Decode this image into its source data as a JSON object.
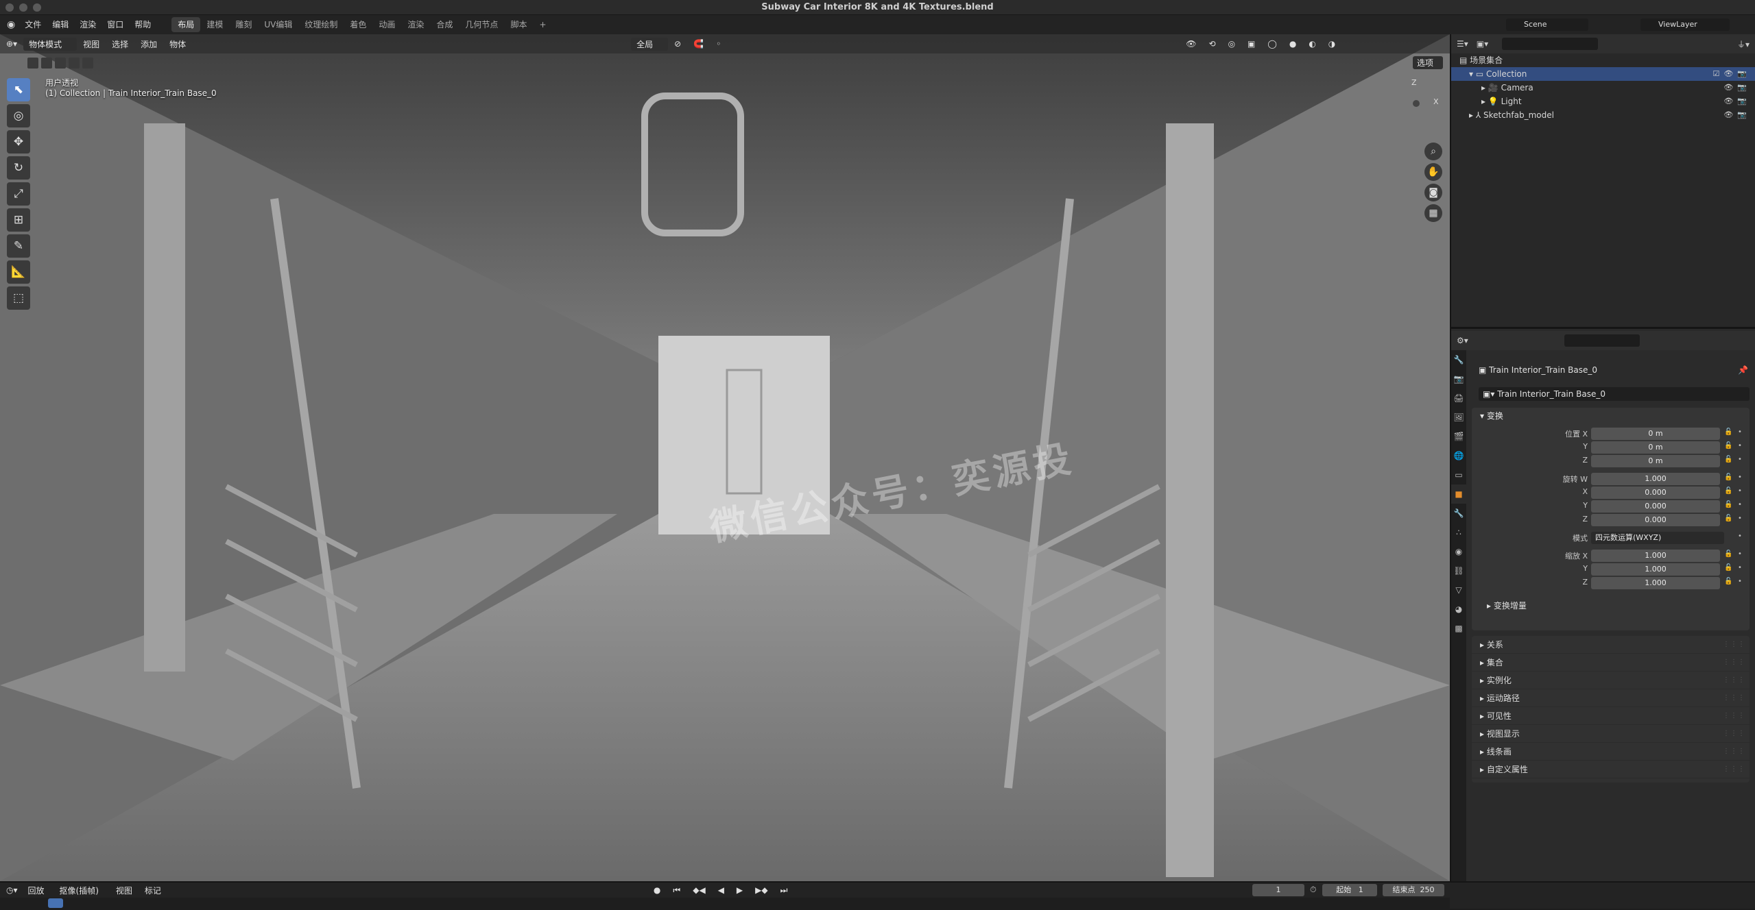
{
  "window": {
    "title": "Subway Car Interior 8K and 4K Textures.blend"
  },
  "menubar": {
    "menus": [
      "文件",
      "编辑",
      "渲染",
      "窗口",
      "帮助"
    ],
    "workspaces": [
      "布局",
      "建模",
      "雕刻",
      "UV编辑",
      "纹理绘制",
      "着色",
      "动画",
      "渲染",
      "合成",
      "几何节点",
      "脚本"
    ],
    "active_workspace": "布局",
    "add_tab": "+",
    "scene_label": "Scene",
    "view_layer_label": "ViewLayer"
  },
  "viewport": {
    "mode_dropdown": "物体模式",
    "menus": [
      "视图",
      "选择",
      "添加",
      "物体"
    ],
    "transform_orientation": "全局",
    "options_label": "选项",
    "view_name": "用户透视",
    "active_info": "(1) Collection | Train Interior_Train Base_0",
    "watermark": "微信公众号：奕源投",
    "gizmo_axes": [
      "Z",
      "X"
    ]
  },
  "tools": [
    {
      "name": "select-box",
      "glyph": "⬉",
      "active": true
    },
    {
      "name": "cursor",
      "glyph": "◎",
      "active": false
    },
    {
      "name": "move",
      "glyph": "✥",
      "active": false
    },
    {
      "name": "rotate",
      "glyph": "↻",
      "active": false
    },
    {
      "name": "scale",
      "glyph": "⤢",
      "active": false
    },
    {
      "name": "transform",
      "glyph": "⊞",
      "active": false
    },
    {
      "name": "annotate",
      "glyph": "✎",
      "active": false
    },
    {
      "name": "measure",
      "glyph": "📐",
      "active": false
    },
    {
      "name": "add-cube",
      "glyph": "⬚",
      "active": false
    }
  ],
  "outliner": {
    "root": "场景集合",
    "items": [
      {
        "label": "Collection",
        "depth": 1,
        "selected": true
      },
      {
        "label": "Camera",
        "depth": 2,
        "selected": false
      },
      {
        "label": "Light",
        "depth": 2,
        "selected": false
      },
      {
        "label": "Sketchfab_model",
        "depth": 1,
        "selected": false
      }
    ]
  },
  "properties": {
    "object_name": "Train Interior_Train Base_0",
    "datablock_name": "Train Interior_Train Base_0",
    "transform_header": "变换",
    "location_label": "位置 X",
    "location": [
      "0 m",
      "0 m",
      "0 m"
    ],
    "rotation_label": "旋转 W",
    "rotation": [
      "1.000",
      "0.000",
      "0.000",
      "0.000"
    ],
    "mode_label": "模式",
    "mode_value": "四元数运算(WXYZ)",
    "scale_label": "缩放 X",
    "scale": [
      "1.000",
      "1.000",
      "1.000"
    ],
    "axis_labels": [
      "Y",
      "Z",
      "X"
    ],
    "delta_transform": "变换增量",
    "sections": [
      "关系",
      "集合",
      "实例化",
      "运动路径",
      "可见性",
      "视图显示",
      "线条画",
      "自定义属性"
    ]
  },
  "timeline": {
    "playback": "回放",
    "keying": "抠像(插帧)",
    "view": "视图",
    "marker": "标记",
    "current_frame": "1",
    "start_label": "起始",
    "start_value": "1",
    "end_label": "结束点",
    "end_value": "250"
  },
  "colors": {
    "accent": "#5680c2",
    "selection": "#334d80",
    "active_tab": "#e38d2c"
  }
}
